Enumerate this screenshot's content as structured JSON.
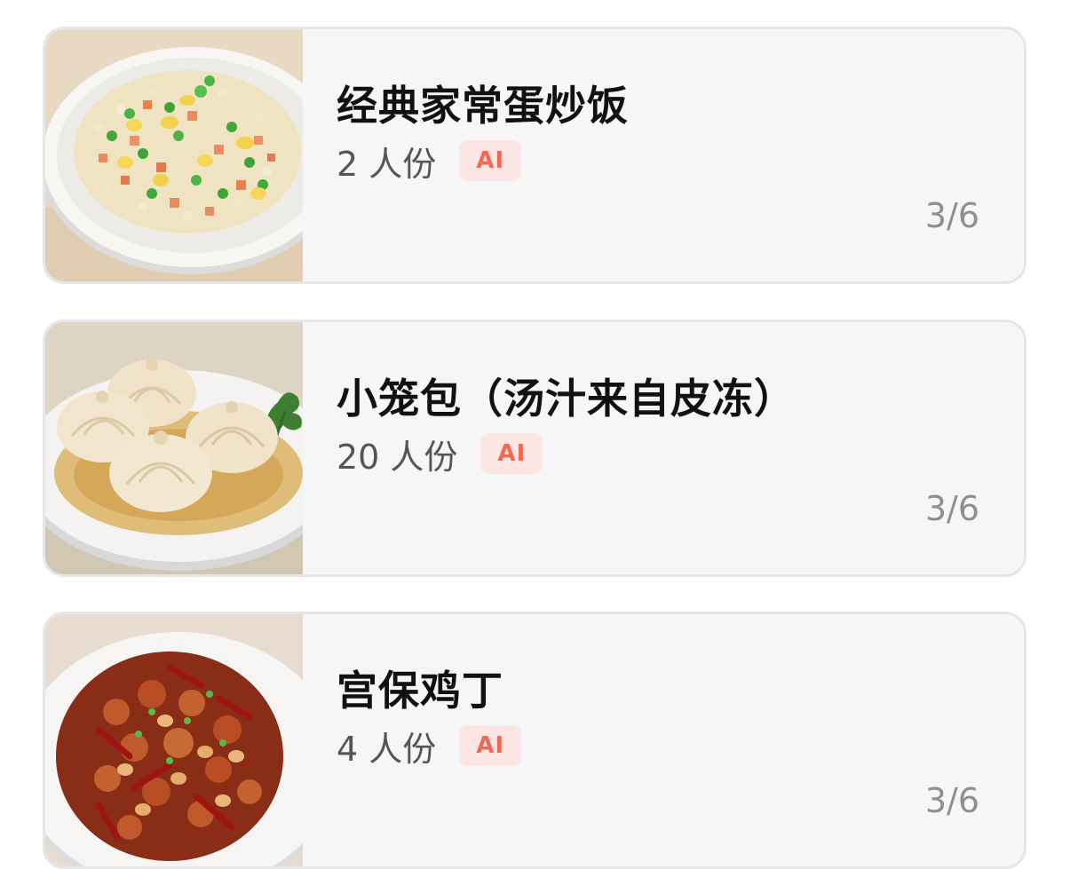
{
  "recipes": [
    {
      "title": "经典家常蛋炒饭",
      "servings": "2 人份",
      "badge": "AI",
      "page": "3/6",
      "image": "fried-rice-image"
    },
    {
      "title": "小笼包（汤汁来自皮冻）",
      "servings": "20 人份",
      "badge": "AI",
      "page": "3/6",
      "image": "soup-dumplings-image"
    },
    {
      "title": "宫保鸡丁",
      "servings": "4 人份",
      "badge": "AI",
      "page": "3/6",
      "image": "kung-pao-chicken-image"
    }
  ],
  "colors": {
    "card_background": "#f6f6f6",
    "card_border": "#e6e6e6",
    "badge_background": "#fbe6e3",
    "badge_text": "#ef6a55",
    "page_indicator": "#8f8f8f"
  }
}
